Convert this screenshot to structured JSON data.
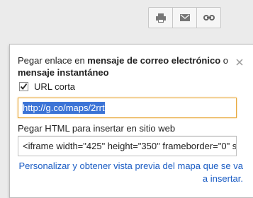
{
  "toolbar": {
    "buttons": [
      {
        "icon": "print-icon"
      },
      {
        "icon": "email-icon"
      },
      {
        "icon": "link-icon"
      }
    ]
  },
  "panel": {
    "heading_prefix": "Pegar enlace en ",
    "heading_bold_1": "mensaje de correo electrónico",
    "heading_connector": " o ",
    "heading_bold_2": "mensaje instantáneo",
    "close_icon": "close-icon",
    "short_url_label": "URL corta",
    "short_url_checked": true,
    "url_value": "http://g.co/maps/2rrt",
    "html_label": "Pegar HTML para insertar en sitio web",
    "embed_value": "<iframe width=\"425\" height=\"350\" frameborder=\"0\" s",
    "customize_link": "Personalizar y obtener vista previa del mapa que se va a insertar."
  },
  "colors": {
    "link": "#1a5cc4",
    "focus_border": "#e7a83a",
    "selection": "#3c74d6"
  }
}
